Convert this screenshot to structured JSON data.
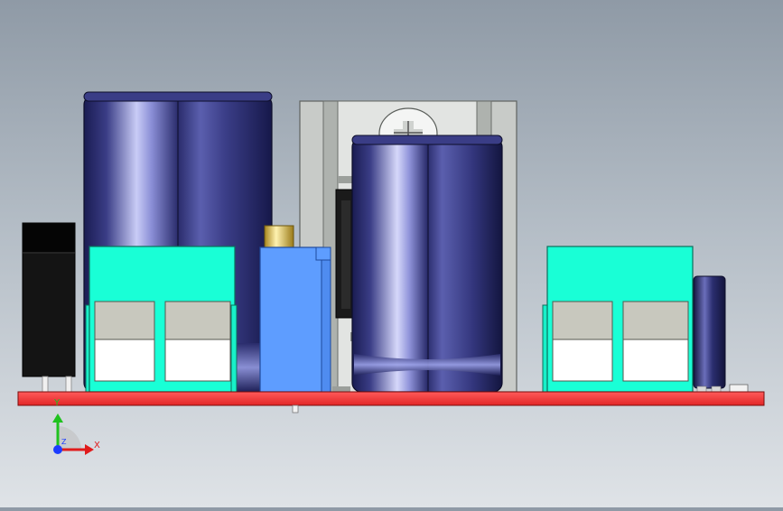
{
  "viewport": {
    "background_top": "#8f9aa6",
    "background_bottom": "#dfe3e7"
  },
  "colors": {
    "pcb": "#ff3b3b",
    "terminal_block": "#19ffd6",
    "trimmer_pot": "#5b9bff",
    "capacitor_dark": "#1d1f5c",
    "capacitor_highlight": "#b6b9f0",
    "heatsink": "#c9ccc9",
    "dc_jack": "#121212"
  },
  "axis_triad": {
    "x_label": "X",
    "y_label": "Y",
    "z_label": "Z",
    "x_color": "#e01b1b",
    "y_color": "#1fc21f",
    "z_color": "#1c3cff"
  }
}
